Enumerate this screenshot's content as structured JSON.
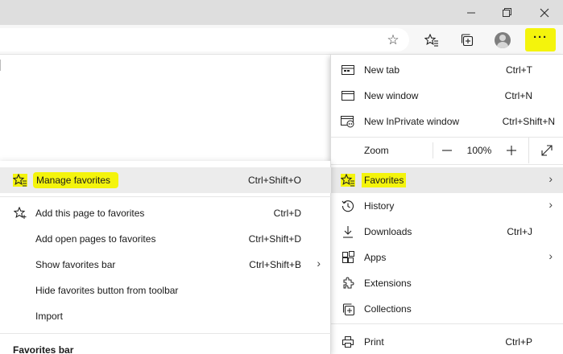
{
  "window": {
    "restore_symbol": "❐",
    "close_symbol": "✕",
    "minimize_symbol": "—"
  },
  "toolbar": {
    "star_icon": "☆",
    "favorites_icon": "favorites-list-icon",
    "collections_icon": "collections-icon",
    "profile_icon": "profile-icon",
    "more_label": "···"
  },
  "highlight_color": "#f4f40c",
  "menu": {
    "items": [
      {
        "label": "New tab",
        "shortcut": "Ctrl+T",
        "icon": "new-tab-icon"
      },
      {
        "label": "New window",
        "shortcut": "Ctrl+N",
        "icon": "new-window-icon"
      },
      {
        "label": "New InPrivate window",
        "shortcut": "Ctrl+Shift+N",
        "icon": "inprivate-icon"
      }
    ],
    "zoom": {
      "label": "Zoom",
      "minus": "—",
      "value": "100%",
      "plus": "+",
      "fullscreen_icon": "fullscreen-icon"
    },
    "favorites": {
      "label": "Favorites",
      "icon": "favorites-list-icon"
    },
    "rest": [
      {
        "label": "History",
        "shortcut": "",
        "icon": "history-icon",
        "submenu": true
      },
      {
        "label": "Downloads",
        "shortcut": "Ctrl+J",
        "icon": "download-icon",
        "submenu": false
      },
      {
        "label": "Apps",
        "shortcut": "",
        "icon": "apps-icon",
        "submenu": true
      },
      {
        "label": "Extensions",
        "shortcut": "",
        "icon": "extensions-icon",
        "submenu": false
      },
      {
        "label": "Collections",
        "shortcut": "",
        "icon": "collections-icon",
        "submenu": false
      },
      {
        "label": "Print",
        "shortcut": "Ctrl+P",
        "icon": "print-icon",
        "submenu": false
      }
    ],
    "chevron": "›"
  },
  "favorites_submenu": {
    "manage": {
      "label": "Manage favorites",
      "shortcut": "Ctrl+Shift+O"
    },
    "items": [
      {
        "label": "Add this page to favorites",
        "shortcut": "Ctrl+D",
        "icon": "star-add-icon"
      },
      {
        "label": "Add open pages to favorites",
        "shortcut": "Ctrl+Shift+D",
        "icon": ""
      },
      {
        "label": "Show favorites bar",
        "shortcut": "Ctrl+Shift+B",
        "icon": ""
      },
      {
        "label": "Hide favorites button from toolbar",
        "shortcut": "",
        "icon": ""
      },
      {
        "label": "Import",
        "shortcut": "",
        "icon": ""
      }
    ],
    "section_title": "Favorites bar"
  }
}
